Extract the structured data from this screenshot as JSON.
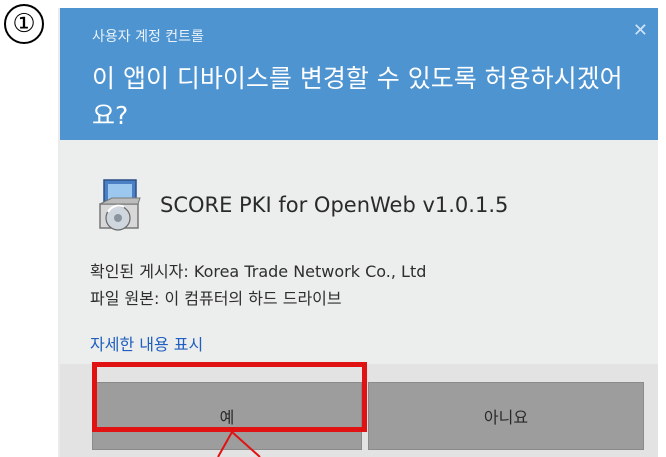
{
  "step_marker": "①",
  "dialog": {
    "title": "사용자 계정 컨트롤",
    "close_glyph": "✕",
    "question": "이 앱이 디바이스를 변경할 수 있도록 허용하시겠어요?",
    "app_name": "SCORE PKI for OpenWeb v1.0.1.5",
    "app_icon": "installer-package-icon",
    "publisher": "확인된 게시자: Korea Trade Network Co., Ltd",
    "origin": "파일 원본: 이 컴퓨터의 하드 드라이브",
    "details_link": "자세한 내용 표시",
    "buttons": {
      "yes": "예",
      "no": "아니요"
    }
  },
  "annotation": {
    "highlight_color": "#e01212"
  },
  "colors": {
    "header_bg": "#4d94d1",
    "body_bg": "#eceded",
    "button_bg": "#9d9d9d",
    "link": "#1f5fbf"
  }
}
